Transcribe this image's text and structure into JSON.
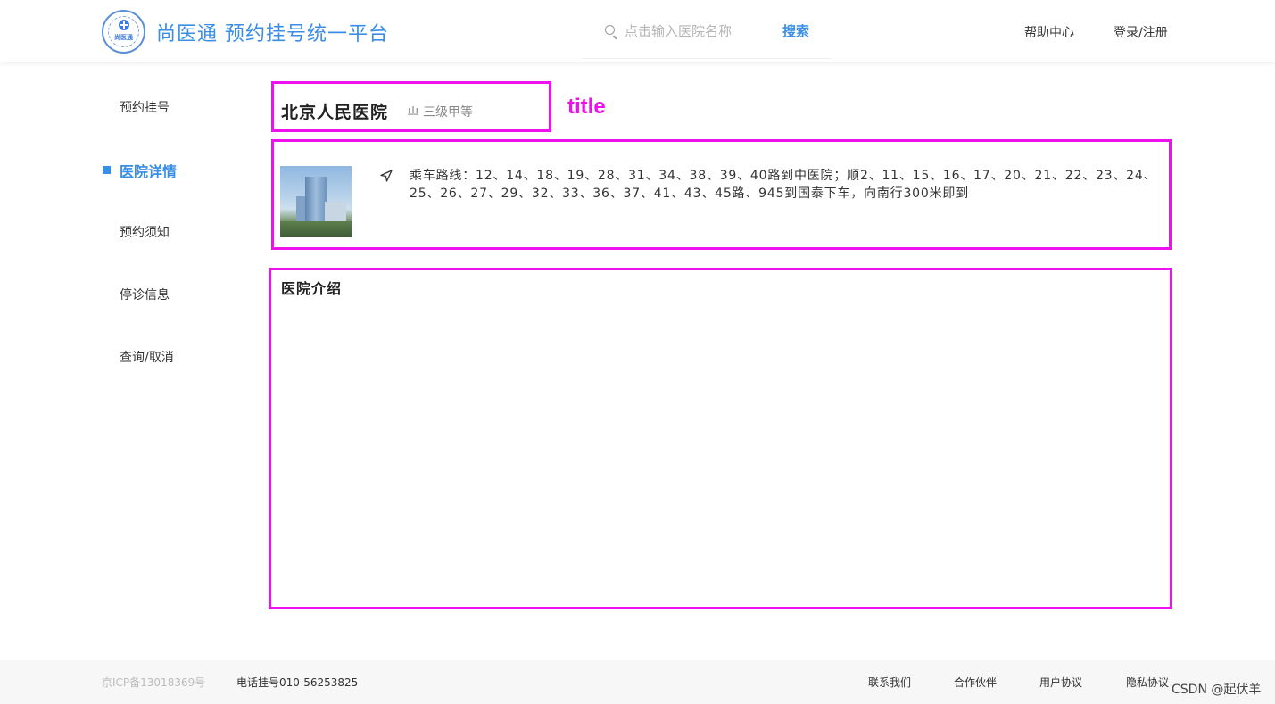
{
  "header": {
    "logo_mini": "尚医通",
    "title": "尚医通 预约挂号统一平台",
    "search_placeholder": "点击输入医院名称",
    "search_button": "搜索",
    "help": "帮助中心",
    "login": "登录/注册"
  },
  "sidebar": {
    "items": [
      {
        "label": "预约挂号",
        "active": false
      },
      {
        "label": "医院详情",
        "active": true
      },
      {
        "label": "预约须知",
        "active": false
      },
      {
        "label": "停诊信息",
        "active": false
      },
      {
        "label": "查询/取消",
        "active": false
      }
    ]
  },
  "hospital": {
    "name": "北京人民医院",
    "level": "三级甲等",
    "route": "乘车路线：12、14、18、19、28、31、34、38、39、40路到中医院；顺2、11、15、16、17、20、21、22、23、24、25、26、27、29、32、33、36、37、41、43、45路、945到国泰下车，向南行300米即到",
    "intro_title": "医院介绍"
  },
  "annotation": {
    "title_label": "title",
    "color": "#ee11ee"
  },
  "footer": {
    "icp": "京ICP备13018369号",
    "tel": "电话挂号010-56253825",
    "links": [
      "联系我们",
      "合作伙伴",
      "用户协议",
      "隐私协议"
    ]
  },
  "watermark": "CSDN @起伏羊",
  "colors": {
    "accent": "#3a8ee6",
    "annotation_border": "#ee11ee"
  }
}
